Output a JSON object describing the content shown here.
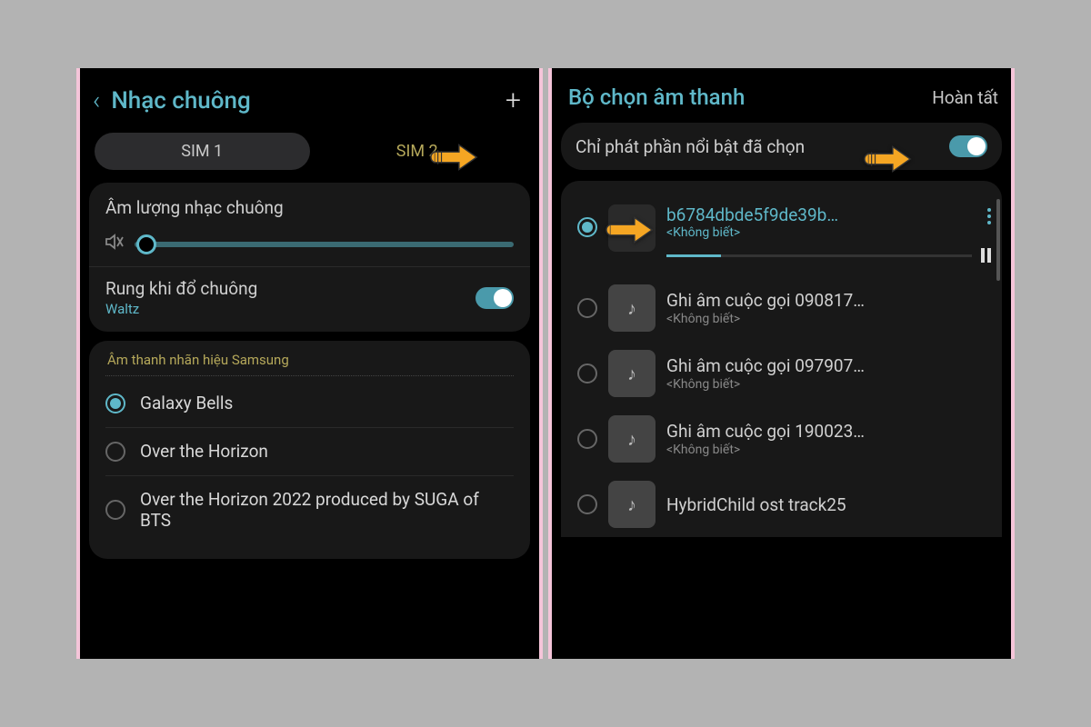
{
  "left": {
    "header_title": "Nhạc chuông",
    "sim1": "SIM 1",
    "sim2": "SIM 2",
    "volume_label": "Âm lượng nhạc chuông",
    "vibrate_label": "Rung khi đổ chuông",
    "vibrate_sub": "Waltz",
    "brand_header": "Âm thanh nhãn hiệu Samsung",
    "tones": [
      {
        "label": "Galaxy Bells",
        "selected": true
      },
      {
        "label": "Over the Horizon",
        "selected": false
      },
      {
        "label": "Over the Horizon 2022 produced by SUGA of BTS",
        "selected": false
      }
    ]
  },
  "right": {
    "header_title": "Bộ chọn âm thanh",
    "done": "Hoàn tất",
    "highlight_label": "Chỉ phát phần nổi bật đã chọn",
    "sounds": [
      {
        "title": "b6784dbde5f9de39b…",
        "sub": "<Không biết>",
        "selected": true,
        "playing": true
      },
      {
        "title": "Ghi âm cuộc gọi 090817…",
        "sub": "<Không biết>",
        "selected": false
      },
      {
        "title": "Ghi âm cuộc gọi 097907…",
        "sub": "<Không biết>",
        "selected": false
      },
      {
        "title": "Ghi âm cuộc gọi 190023…",
        "sub": "<Không biết>",
        "selected": false
      },
      {
        "title": "HybridChild ost track25",
        "sub": "",
        "selected": false
      }
    ]
  }
}
